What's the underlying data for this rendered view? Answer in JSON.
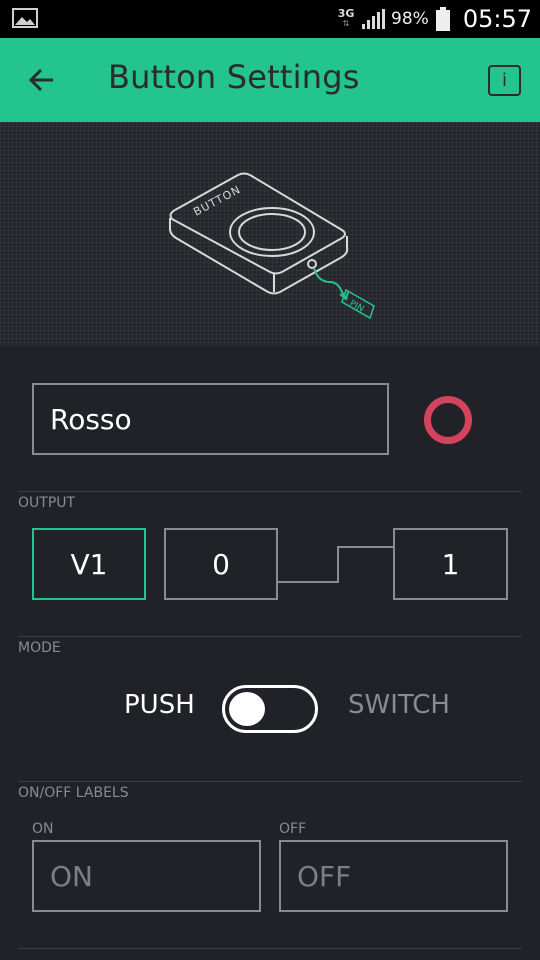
{
  "status_bar": {
    "network": "3G",
    "battery": "98%",
    "time": "05:57",
    "icons": [
      "gallery-icon",
      "data-arrows-icon",
      "signal-icon",
      "battery-icon"
    ]
  },
  "app_bar": {
    "title": "Button Settings",
    "back_icon": "arrow-left-icon",
    "info_label": "i",
    "color": "#23c48e"
  },
  "illustration": {
    "device_label": "BUTTON",
    "pin_label": "PIN"
  },
  "name_field": {
    "value": "Rosso",
    "color_swatch": "#d3435c"
  },
  "output": {
    "section_label": "OUTPUT",
    "pin": "V1",
    "low_value": "0",
    "high_value": "1"
  },
  "mode": {
    "section_label": "MODE",
    "push_label": "PUSH",
    "switch_label": "SWITCH",
    "selected": "PUSH"
  },
  "labels": {
    "section_label": "ON/OFF LABELS",
    "on_caption": "ON",
    "off_caption": "OFF",
    "on_placeholder": "ON",
    "off_placeholder": "OFF"
  }
}
